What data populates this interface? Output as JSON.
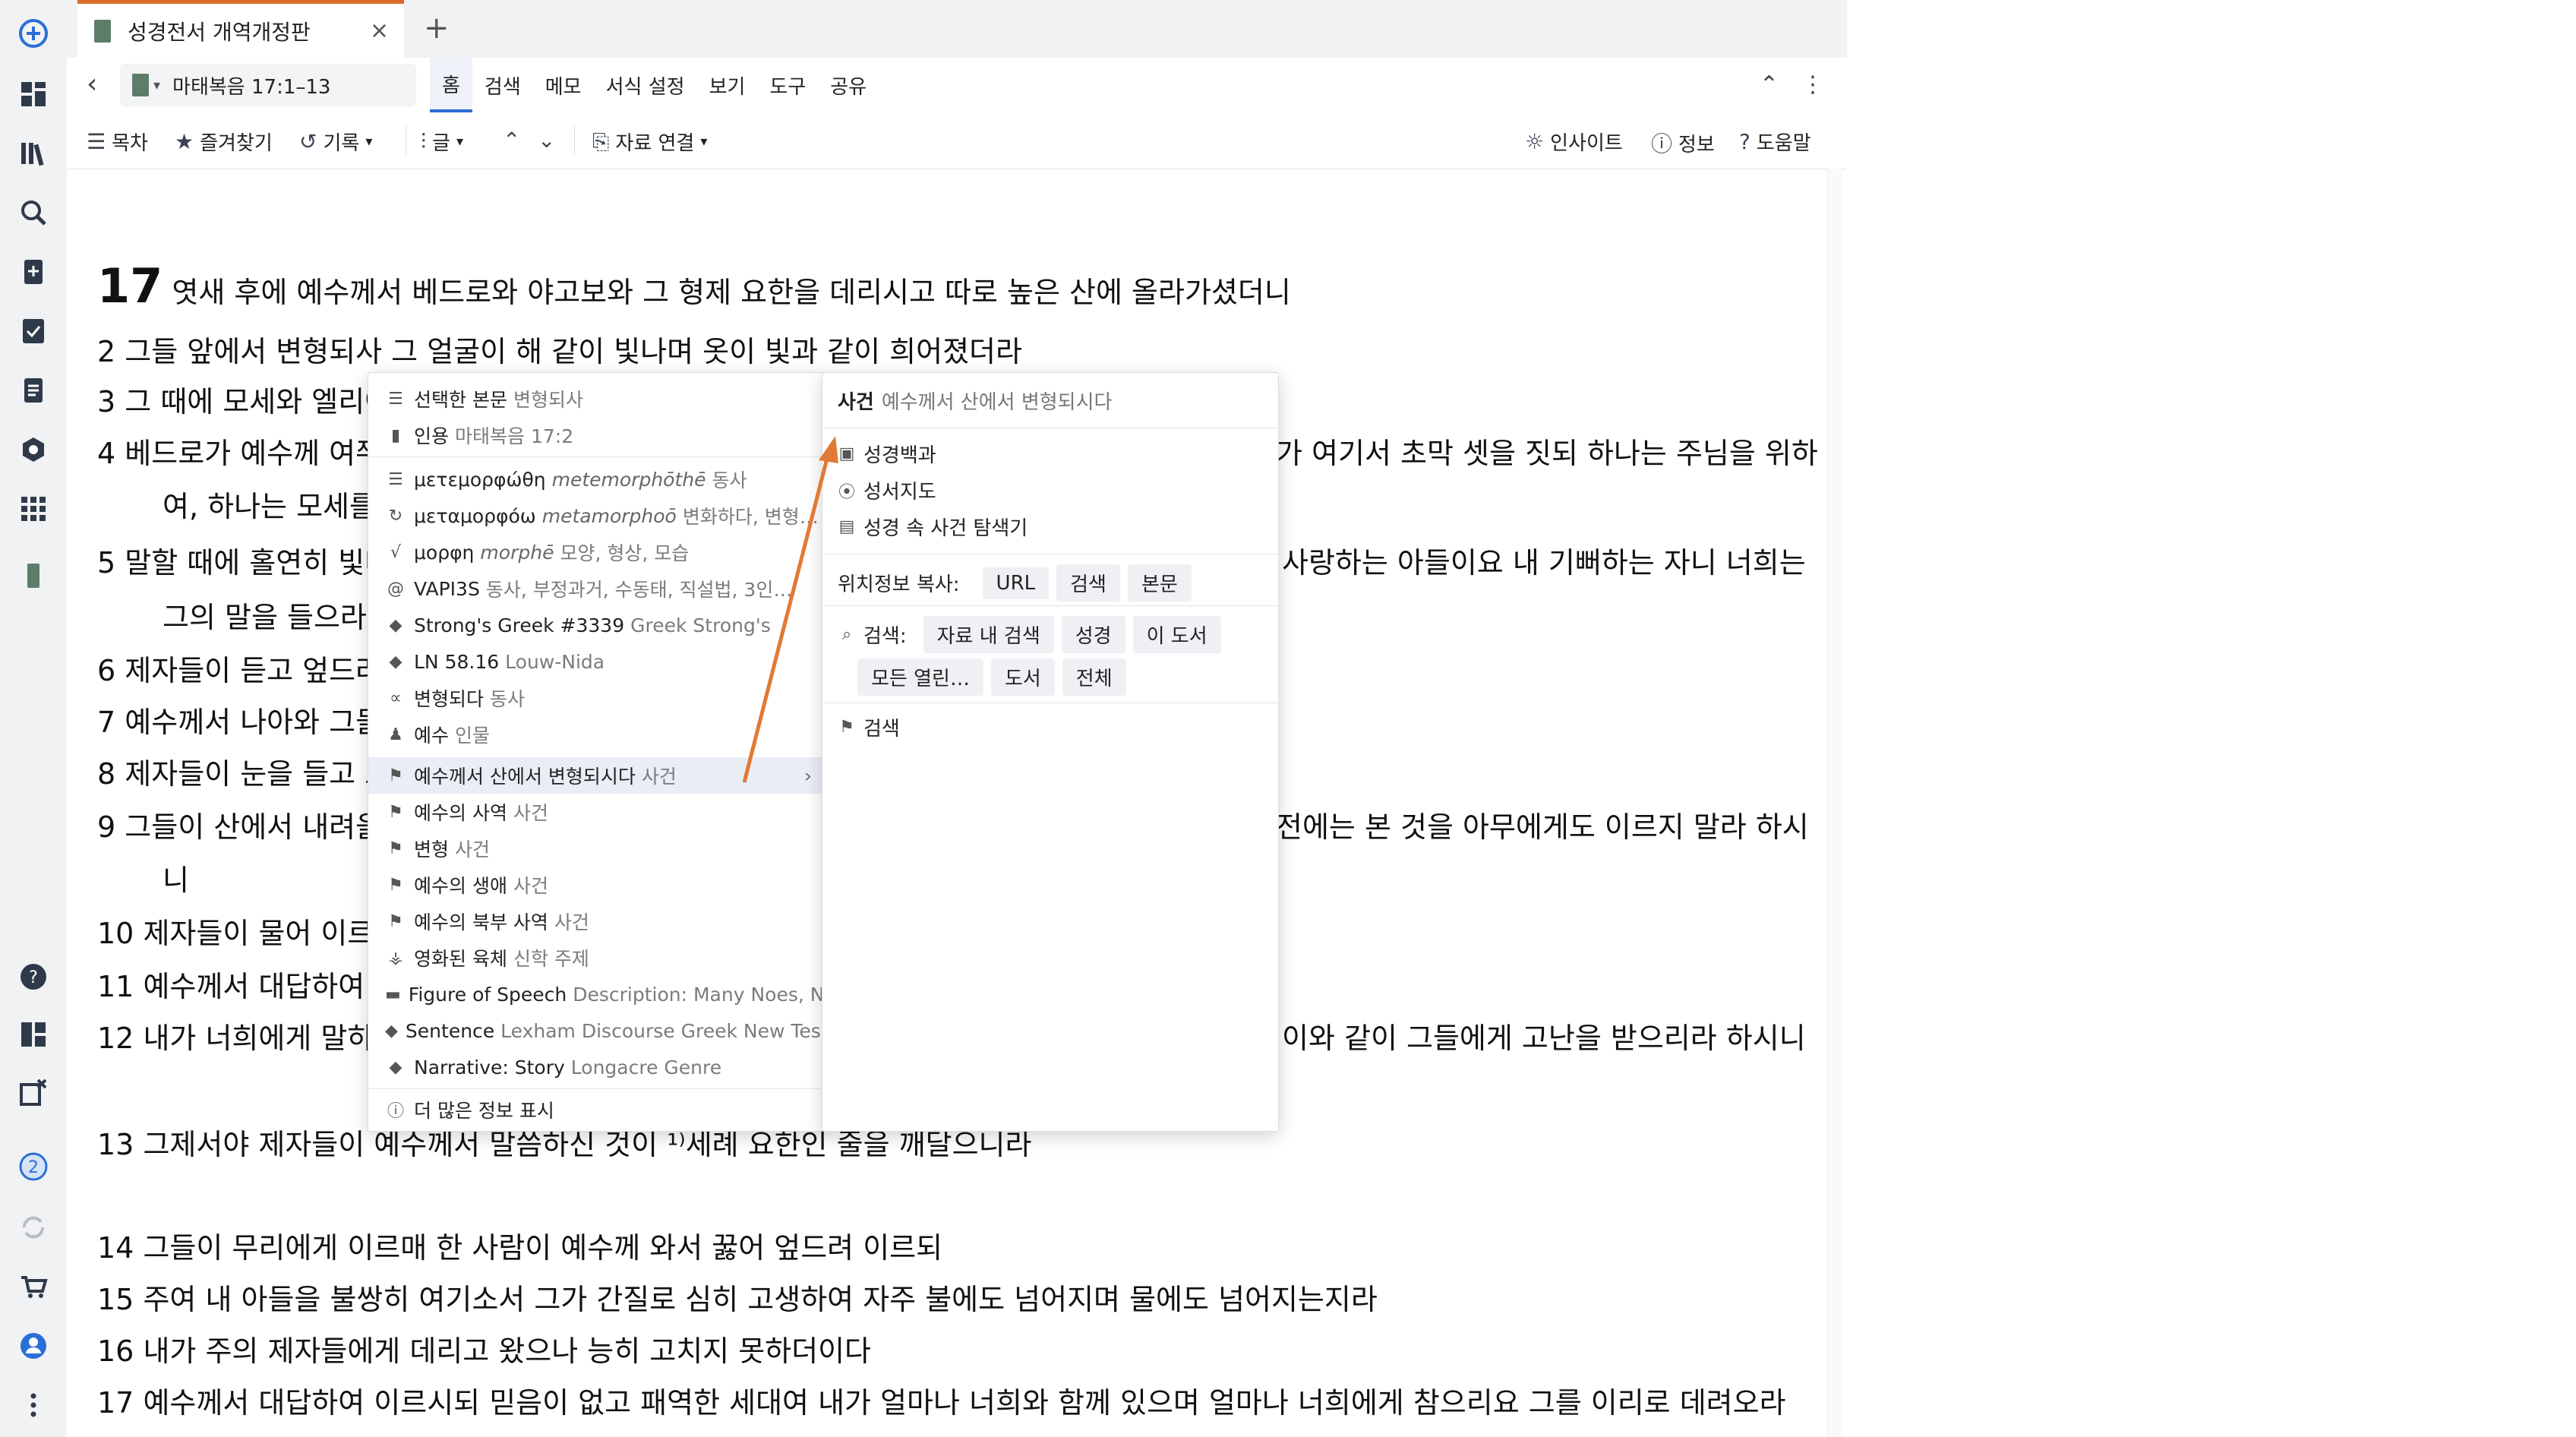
{
  "tab": {
    "title": "성경전서 개역개정판",
    "close": "×",
    "new": "+"
  },
  "nav": {
    "back": "‹",
    "reference": "마태복음 17:1–13",
    "menus": [
      "홈",
      "검색",
      "메모",
      "서식 설정",
      "보기",
      "도구",
      "공유"
    ]
  },
  "toolbar": {
    "toc": "목차",
    "favorites": "즐겨찾기",
    "history": "기록",
    "text": "글",
    "link": "자료 연결",
    "insight": "인사이트",
    "info": "정보",
    "help": "도움말"
  },
  "verses": [
    {
      "num": "17",
      "text": "엿새 후에 예수께서 베드로와 야고보와 그 형제 요한을 데리시고 따로 높은 산에 올라가셨더니"
    },
    {
      "num": "2",
      "text": "그들 앞에서 변형되사 그 얼굴이 해 같이 빛나며 옷이 빛과 같이 희어졌더라"
    },
    {
      "num": "3",
      "text": "그 때에 모세와 엘리아"
    },
    {
      "num": "4",
      "text": "베드로가 예수께 여쭈",
      "tail": "가 여기서 초막 셋을 짓되 하나는 주님을 위하"
    },
    {
      "num": "",
      "text": "여, 하나는 모세를"
    },
    {
      "num": "5",
      "text": "말할 때에 홀연히 빛나",
      "tail": "사랑하는 아들이요 내 기뻐하는 자니 너희는"
    },
    {
      "num": "",
      "text": "그의 말을 들으라"
    },
    {
      "num": "6",
      "text": "제자들이 듣고 엎드려"
    },
    {
      "num": "7",
      "text": "예수께서 나아와 그들"
    },
    {
      "num": "8",
      "text": "제자들이 눈을 들고 보"
    },
    {
      "num": "9",
      "text": "그들이 산에서 내려올",
      "tail": "전에는 본 것을 아무에게도 이르지 말라 하시"
    },
    {
      "num": "",
      "text": "니"
    },
    {
      "num": "10",
      "text": "제자들이 물어 이르되"
    },
    {
      "num": "11",
      "text": "예수께서 대답하여 이"
    },
    {
      "num": "12",
      "text": "내가 너희에게 말하노",
      "tail": "이와 같이 그들에게 고난을 받으리라 하시니"
    },
    {
      "num": "13",
      "text": "그제서야 제자들이 예수께서 말씀하신 것이 ¹⁾세례 요한인 줄을 깨달으니라"
    },
    {
      "num": "14",
      "text": "그들이 무리에게 이르매 한 사람이 예수께 와서 꿇어 엎드려 이르되"
    },
    {
      "num": "15",
      "text": "주여 내 아들을 불쌍히 여기소서 그가 간질로 심히 고생하여 자주 불에도 넘어지며 물에도 넘어지는지라"
    },
    {
      "num": "16",
      "text": "내가 주의 제자들에게 데리고 왔으나 능히 고치지 못하더이다"
    },
    {
      "num": "17",
      "text": "예수께서 대답하여 이르시되 믿음이 없고 패역한 세대여 내가 얼마나 너희와 함께 있으며 얼마나 너희에게 참으리요 그를 이리로 데려오라"
    }
  ],
  "context_menu": [
    {
      "t": "선택한 본문",
      "g": "변형되사"
    },
    {
      "t": "인용",
      "g": "마태복음 17:2"
    },
    {
      "t": "μετεμορφώθη",
      "it": "metemorphōthē",
      "g": "동사"
    },
    {
      "t": "μεταμορφόω",
      "it": "metamorphoō",
      "g": "변화하다, 변형…"
    },
    {
      "t": "μορφη",
      "it": "morphē",
      "g": "모양, 형상, 모습"
    },
    {
      "t": "VAPI3S",
      "g": "동사, 부정과거, 수동태, 직설법, 3인…"
    },
    {
      "t": "Strong's Greek #3339",
      "g": "Greek Strong's"
    },
    {
      "t": "LN 58.16",
      "g": "Louw-Nida"
    },
    {
      "t": "변형되다",
      "g": "동사"
    },
    {
      "t": "예수",
      "g": "인물"
    },
    {
      "t": "예수께서 산에서 변형되시다",
      "g": "사건"
    },
    {
      "t": "예수의 사역",
      "g": "사건"
    },
    {
      "t": "변형",
      "g": "사건"
    },
    {
      "t": "예수의 생애",
      "g": "사건"
    },
    {
      "t": "예수의 북부 사역",
      "g": "사건"
    },
    {
      "t": "영화된 육체",
      "g": "신학 주제"
    },
    {
      "t": "Figure of Speech",
      "g": "Description: Many Noes, N…"
    },
    {
      "t": "Sentence",
      "g": "Lexham Discourse Greek New Tes…"
    },
    {
      "t": "Narrative: Story",
      "g": "Longacre Genre"
    },
    {
      "t": "더 많은 정보 표시",
      "g": ""
    }
  ],
  "submenu": {
    "heading": "사건",
    "heading_sub": "예수께서 산에서 변형되시다",
    "items": [
      "성경백과",
      "성서지도",
      "성경 속 사건 탐색기"
    ],
    "copy_label": "위치정보 복사:",
    "copy_chips": [
      "URL",
      "검색",
      "본문"
    ],
    "search_label": "검색:",
    "search_chips": [
      "자료 내 검색",
      "성경",
      "이 도서",
      "모든 열린…",
      "도서",
      "전체"
    ],
    "search_item": "검색"
  },
  "colors": {
    "accent": "#2a6fd6",
    "tab_accent": "#d96c2a",
    "arrow": "#e07a35"
  }
}
